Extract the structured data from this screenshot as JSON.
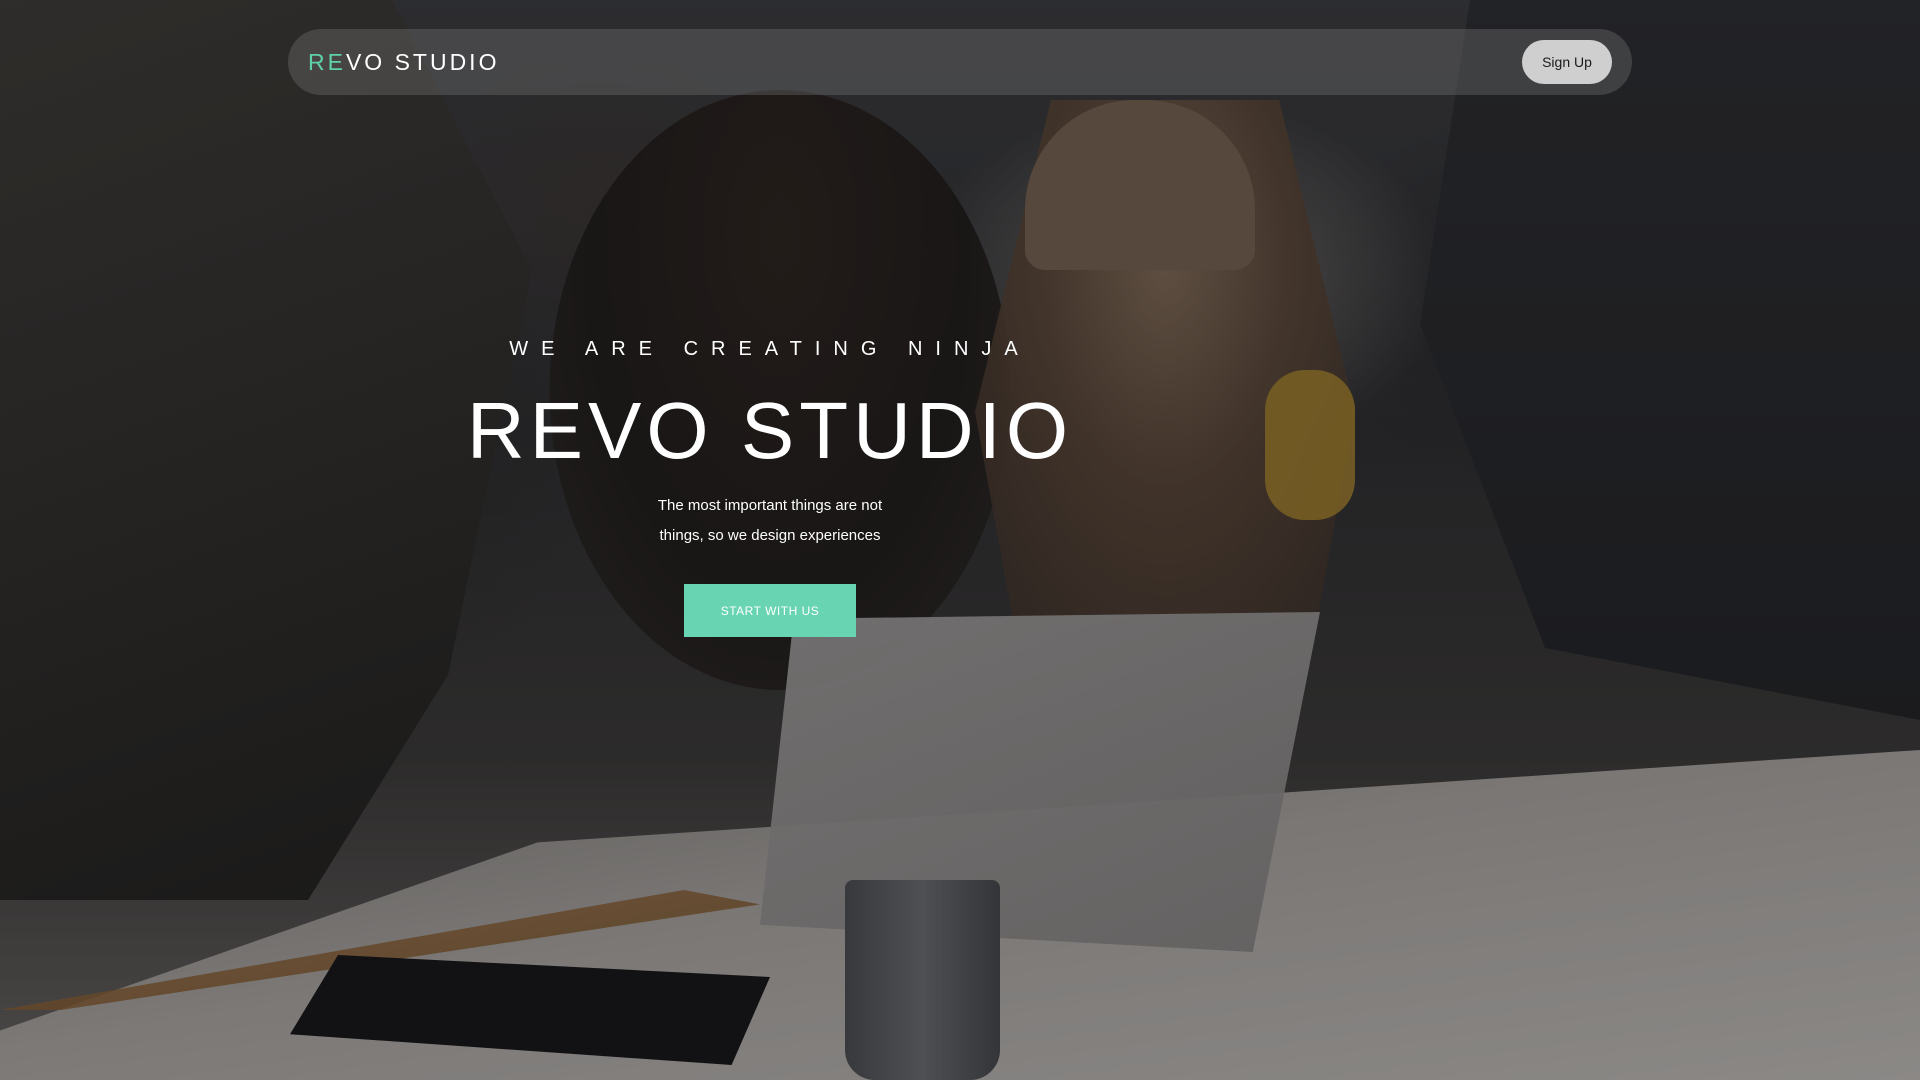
{
  "nav": {
    "brand_accent": "RE",
    "brand_rest": "VO STUDIO",
    "signup_label": "Sign Up"
  },
  "hero": {
    "tagline": "WE ARE CREATING NINJA",
    "title": "REVO STUDIO",
    "subtitle": "The most important things are not things, so we design experiences",
    "cta_label": "START WITH US"
  },
  "colors": {
    "accent": "#69d4b1",
    "brand_accent": "#5fd1a9",
    "nav_background": "rgba(120,120,120,0.35)",
    "signup_background": "#cfcfcf"
  }
}
